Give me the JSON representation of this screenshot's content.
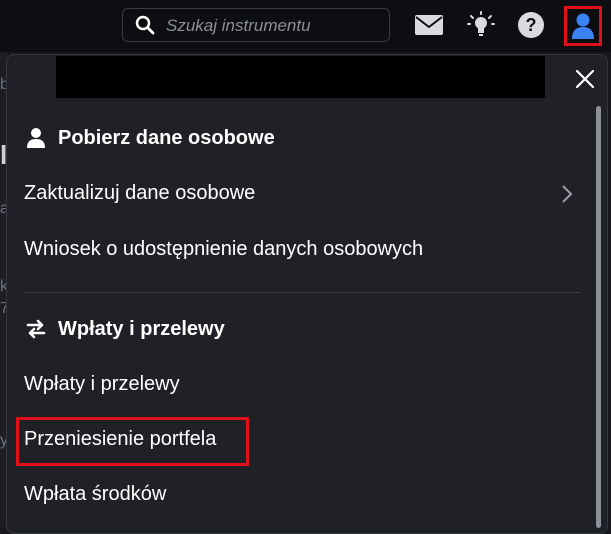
{
  "topbar": {
    "search_placeholder": "Szukaj instrumentu",
    "icons": [
      "search-icon",
      "mail-icon",
      "lightbulb-icon",
      "help-icon",
      "user-icon"
    ]
  },
  "background": {
    "chars": [
      "b",
      "l",
      "a",
      "k",
      "7",
      "y"
    ]
  },
  "menu": {
    "personal_section": {
      "title": "Pobierz dane osobowe",
      "icon": "person-icon",
      "items": [
        {
          "label": "Zaktualizuj dane osobowe",
          "has_submenu": true
        },
        {
          "label": "Wniosek o udostępnienie danych osobowych"
        }
      ]
    },
    "transfers_section": {
      "title": "Wpłaty i przelewy",
      "icon": "transfer-arrows-icon",
      "items": [
        {
          "label": "Wpłaty i przelewy"
        },
        {
          "label": "Przeniesienie portfela",
          "highlighted": true
        },
        {
          "label": "Wpłata środków"
        }
      ]
    }
  },
  "colors": {
    "highlight": "#e0101a",
    "user_icon": "#3b82f6"
  }
}
